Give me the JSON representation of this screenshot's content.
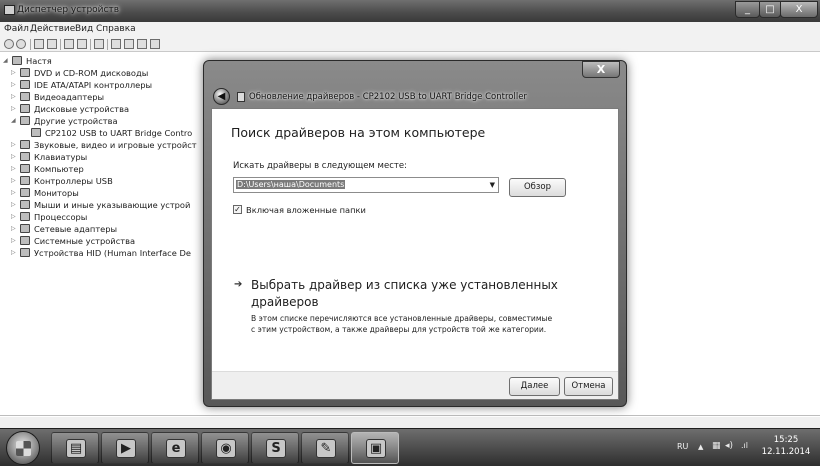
{
  "window": {
    "title": "Диспетчер устройств",
    "minimize": "_",
    "maximize": "□",
    "close": "X"
  },
  "menu": [
    "Файл",
    "Действие",
    "Вид",
    "Справка"
  ],
  "toolbar_icons": [
    "back-icon",
    "forward-icon",
    "properties-icon",
    "show-hidden-icon",
    "help-icon",
    "view-icon",
    "scan-hardware-icon",
    "update-driver-icon",
    "uninstall-icon",
    "disable-icon"
  ],
  "tree": {
    "root": "Настя",
    "items": [
      {
        "label": "DVD и CD-ROM дисководы",
        "icon": "dvd-drive-icon",
        "expander": "▷"
      },
      {
        "label": "IDE ATA/ATAPI контроллеры",
        "icon": "ide-controller-icon",
        "expander": "▷"
      },
      {
        "label": "Видеоадаптеры",
        "icon": "display-adapter-icon",
        "expander": "▷"
      },
      {
        "label": "Дисковые устройства",
        "icon": "disk-drive-icon",
        "expander": "▷"
      },
      {
        "label": "Другие устройства",
        "icon": "other-devices-icon",
        "expander": "◢"
      },
      {
        "label": "CP2102 USB to UART Bridge Contro",
        "icon": "unknown-device-icon",
        "expander": ""
      },
      {
        "label": "Звуковые, видео и игровые устройст",
        "icon": "sound-icon",
        "expander": "▷"
      },
      {
        "label": "Клавиатуры",
        "icon": "keyboard-icon",
        "expander": "▷"
      },
      {
        "label": "Компьютер",
        "icon": "computer-icon",
        "expander": "▷"
      },
      {
        "label": "Контроллеры USB",
        "icon": "usb-icon",
        "expander": "▷"
      },
      {
        "label": "Мониторы",
        "icon": "monitor-icon",
        "expander": "▷"
      },
      {
        "label": "Мыши и иные указывающие устрой",
        "icon": "mouse-icon",
        "expander": "▷"
      },
      {
        "label": "Процессоры",
        "icon": "processor-icon",
        "expander": "▷"
      },
      {
        "label": "Сетевые адаптеры",
        "icon": "network-adapter-icon",
        "expander": "▷"
      },
      {
        "label": "Системные устройства",
        "icon": "system-devices-icon",
        "expander": "▷"
      },
      {
        "label": "Устройства HID (Human Interface De",
        "icon": "hid-icon",
        "expander": "▷"
      }
    ]
  },
  "dialog": {
    "title": "Обновление драйверов - CP2102 USB to UART Bridge Controller",
    "heading": "Поиск драйверов на этом компьютере",
    "path_label": "Искать драйверы в следующем месте:",
    "path_value": "D:\\Users\\наша\\Documents",
    "browse_button": "Обзор",
    "include_subfolders": "Включая вложенные папки",
    "include_subfolders_checked": true,
    "pick_option_title_line1": "Выбрать драйвер из списка уже установленных",
    "pick_option_title_line2": "драйверов",
    "pick_option_desc_line1": "В этом списке перечисляются все установленные драйверы, совместимые",
    "pick_option_desc_line2": "с этим устройством, а также драйверы для устройств той же категории.",
    "next_button": "Далее",
    "cancel_button": "Отмена",
    "close": "X",
    "back": "◀",
    "arrow": "➔",
    "check": "✓",
    "dropdown": "▼"
  },
  "taskbar": {
    "apps": [
      "explorer-icon",
      "media-player-icon",
      "internet-explorer-icon",
      "firefox-icon",
      "skype-icon",
      "paint-icon",
      "device-manager-icon"
    ],
    "app_glyphs": [
      "▤",
      "▶",
      "e",
      "◉",
      "S",
      "✎",
      "▣"
    ],
    "language": "RU",
    "tray_arrow": "▲",
    "time": "15:25",
    "date": "12.11.2014"
  }
}
